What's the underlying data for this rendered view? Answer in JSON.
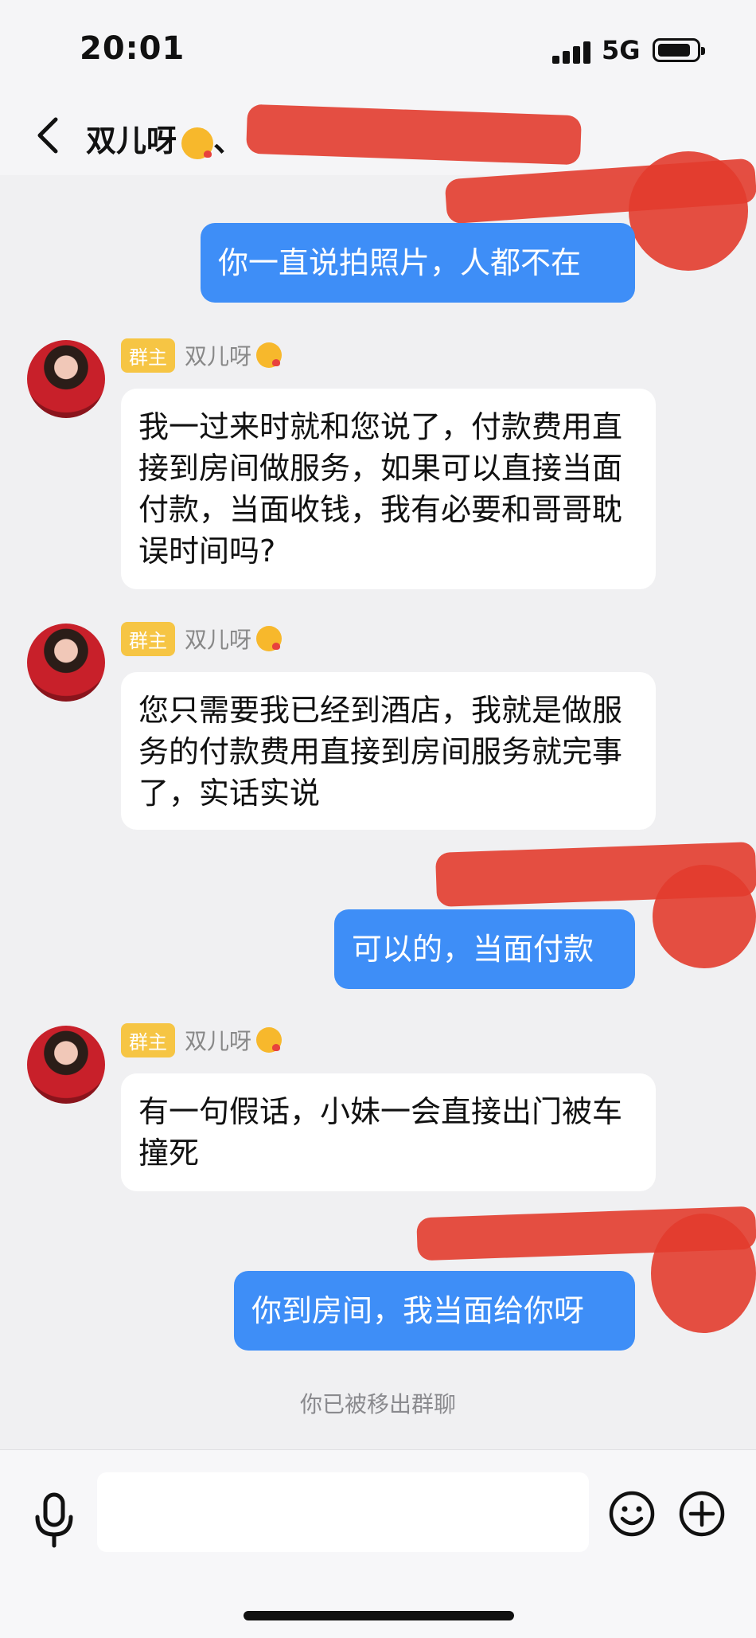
{
  "status": {
    "time": "20:01",
    "network": "5G",
    "battery_level": 0.9
  },
  "header": {
    "title": "双儿呀",
    "title_suffix": "、"
  },
  "messages": [
    {
      "side": "me",
      "text": "你一直说拍照片，人都不在"
    },
    {
      "side": "other",
      "badge": "群主",
      "sender": "双儿呀",
      "text": "我一过来时就和您说了，付款费用直接到房间做服务，如果可以直接当面付款，当面收钱，我有必要和哥哥耽误时间吗?"
    },
    {
      "side": "other",
      "badge": "群主",
      "sender": "双儿呀",
      "text": "您只需要我已经到酒店，我就是做服务的付款费用直接到房间服务就完事了，实话实说"
    },
    {
      "side": "me",
      "text": "可以的，当面付款"
    },
    {
      "side": "other",
      "badge": "群主",
      "sender": "双儿呀",
      "text": "有一句假话，小妹一会直接出门被车撞死"
    },
    {
      "side": "me",
      "text": "你到房间，我当面给你呀"
    }
  ],
  "system_notice": "你已被移出群聊",
  "icons": {
    "back": "chevron-left-icon",
    "mic": "microphone-icon",
    "emoji": "smiley-icon",
    "plus": "plus-circle-icon"
  },
  "colors": {
    "my_bubble": "#3e8ef7",
    "badge": "#f6c544",
    "redaction": "#e23c2e"
  }
}
